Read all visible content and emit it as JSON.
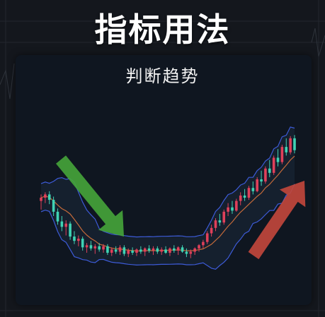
{
  "title": "指标用法",
  "panel": {
    "title": "判断趋势"
  },
  "colors": {
    "background": "#14171d",
    "panel": "#0f1620",
    "bull": "#e0405a",
    "bear": "#3fd3b4",
    "band": "#3d5bd8",
    "middle": "#c46a3a",
    "arrow_down": "#44a33a",
    "arrow_up": "#c0463c"
  },
  "chart_data": {
    "type": "candlestick",
    "indicator": "bollinger-bands",
    "series": [
      {
        "o": 52,
        "h": 58,
        "l": 44,
        "c": 55
      },
      {
        "o": 55,
        "h": 60,
        "l": 50,
        "c": 58
      },
      {
        "o": 58,
        "h": 61,
        "l": 49,
        "c": 53
      },
      {
        "o": 53,
        "h": 56,
        "l": 38,
        "c": 42
      },
      {
        "o": 42,
        "h": 45,
        "l": 30,
        "c": 33
      },
      {
        "o": 33,
        "h": 38,
        "l": 24,
        "c": 28
      },
      {
        "o": 28,
        "h": 34,
        "l": 20,
        "c": 31
      },
      {
        "o": 31,
        "h": 33,
        "l": 16,
        "c": 19
      },
      {
        "o": 19,
        "h": 24,
        "l": 12,
        "c": 15
      },
      {
        "o": 15,
        "h": 20,
        "l": 10,
        "c": 17
      },
      {
        "o": 17,
        "h": 19,
        "l": 6,
        "c": 9
      },
      {
        "o": 9,
        "h": 13,
        "l": 4,
        "c": 11
      },
      {
        "o": 11,
        "h": 15,
        "l": 6,
        "c": 8
      },
      {
        "o": 8,
        "h": 12,
        "l": 3,
        "c": 10
      },
      {
        "o": 10,
        "h": 13,
        "l": 5,
        "c": 7
      },
      {
        "o": 7,
        "h": 12,
        "l": 4,
        "c": 10
      },
      {
        "o": 10,
        "h": 12,
        "l": 2,
        "c": 4
      },
      {
        "o": 4,
        "h": 9,
        "l": 1,
        "c": 7
      },
      {
        "o": 7,
        "h": 10,
        "l": 3,
        "c": 5
      },
      {
        "o": 5,
        "h": 11,
        "l": 2,
        "c": 9
      },
      {
        "o": 9,
        "h": 11,
        "l": 1,
        "c": 3
      },
      {
        "o": 3,
        "h": 8,
        "l": 0,
        "c": 6
      },
      {
        "o": 6,
        "h": 9,
        "l": 2,
        "c": 4
      },
      {
        "o": 4,
        "h": 8,
        "l": 1,
        "c": 7
      },
      {
        "o": 7,
        "h": 10,
        "l": 3,
        "c": 5
      },
      {
        "o": 5,
        "h": 9,
        "l": 1,
        "c": 8
      },
      {
        "o": 8,
        "h": 11,
        "l": 4,
        "c": 6
      },
      {
        "o": 6,
        "h": 10,
        "l": 2,
        "c": 8
      },
      {
        "o": 8,
        "h": 10,
        "l": 3,
        "c": 5
      },
      {
        "o": 5,
        "h": 9,
        "l": 2,
        "c": 7
      },
      {
        "o": 7,
        "h": 10,
        "l": 3,
        "c": 4
      },
      {
        "o": 4,
        "h": 9,
        "l": 1,
        "c": 8
      },
      {
        "o": 8,
        "h": 11,
        "l": 4,
        "c": 6
      },
      {
        "o": 6,
        "h": 10,
        "l": 2,
        "c": 9
      },
      {
        "o": 9,
        "h": 11,
        "l": 4,
        "c": 5
      },
      {
        "o": 5,
        "h": 8,
        "l": 0,
        "c": 3
      },
      {
        "o": 3,
        "h": 7,
        "l": -1,
        "c": 5
      },
      {
        "o": 5,
        "h": 9,
        "l": 2,
        "c": 8
      },
      {
        "o": 8,
        "h": 12,
        "l": 5,
        "c": 11
      },
      {
        "o": 11,
        "h": 16,
        "l": 8,
        "c": 14
      },
      {
        "o": 14,
        "h": 24,
        "l": 12,
        "c": 22
      },
      {
        "o": 22,
        "h": 30,
        "l": 19,
        "c": 27
      },
      {
        "o": 27,
        "h": 36,
        "l": 24,
        "c": 34
      },
      {
        "o": 34,
        "h": 40,
        "l": 29,
        "c": 32
      },
      {
        "o": 32,
        "h": 44,
        "l": 30,
        "c": 42
      },
      {
        "o": 42,
        "h": 50,
        "l": 38,
        "c": 46
      },
      {
        "o": 46,
        "h": 52,
        "l": 40,
        "c": 43
      },
      {
        "o": 43,
        "h": 54,
        "l": 42,
        "c": 52
      },
      {
        "o": 52,
        "h": 60,
        "l": 48,
        "c": 57
      },
      {
        "o": 57,
        "h": 63,
        "l": 52,
        "c": 55
      },
      {
        "o": 55,
        "h": 66,
        "l": 53,
        "c": 64
      },
      {
        "o": 64,
        "h": 70,
        "l": 58,
        "c": 61
      },
      {
        "o": 61,
        "h": 74,
        "l": 60,
        "c": 72
      },
      {
        "o": 72,
        "h": 80,
        "l": 66,
        "c": 70
      },
      {
        "o": 70,
        "h": 84,
        "l": 68,
        "c": 82
      },
      {
        "o": 82,
        "h": 90,
        "l": 74,
        "c": 78
      },
      {
        "o": 78,
        "h": 94,
        "l": 76,
        "c": 92
      },
      {
        "o": 92,
        "h": 100,
        "l": 84,
        "c": 88
      },
      {
        "o": 88,
        "h": 104,
        "l": 86,
        "c": 102
      },
      {
        "o": 102,
        "h": 110,
        "l": 94,
        "c": 97
      },
      {
        "o": 97,
        "h": 112,
        "l": 95,
        "c": 110
      },
      {
        "o": 110,
        "h": 113,
        "l": 96,
        "c": 99
      }
    ],
    "ylim": [
      -30,
      140
    ]
  }
}
